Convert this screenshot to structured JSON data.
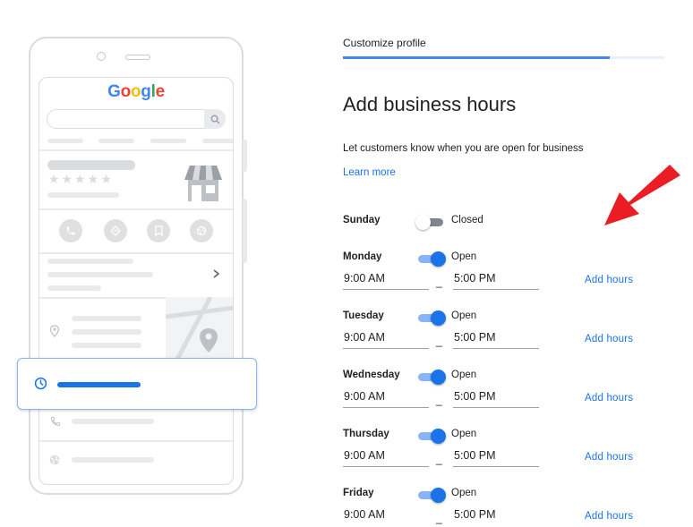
{
  "illustration": {
    "logo": [
      "G",
      "o",
      "o",
      "g",
      "l",
      "e"
    ]
  },
  "header": {
    "breadcrumb": "Customize profile",
    "progress_fraction": 0.83
  },
  "main": {
    "title": "Add business hours",
    "subtitle": "Let customers know when you are open for business",
    "learn_more": "Learn more",
    "separator": "_",
    "add_hours_label": "Add hours",
    "days": [
      {
        "name": "Sunday",
        "status": "Closed",
        "open": false
      },
      {
        "name": "Monday",
        "status": "Open",
        "open": true,
        "opens": "9:00 AM",
        "closes": "5:00 PM"
      },
      {
        "name": "Tuesday",
        "status": "Open",
        "open": true,
        "opens": "9:00 AM",
        "closes": "5:00 PM"
      },
      {
        "name": "Wednesday",
        "status": "Open",
        "open": true,
        "opens": "9:00 AM",
        "closes": "5:00 PM"
      },
      {
        "name": "Thursday",
        "status": "Open",
        "open": true,
        "opens": "9:00 AM",
        "closes": "5:00 PM"
      },
      {
        "name": "Friday",
        "status": "Open",
        "open": true,
        "opens": "9:00 AM",
        "closes": "5:00 PM"
      }
    ]
  },
  "colors": {
    "accent": "#1a73e8",
    "arrow": "#ea1c24"
  }
}
